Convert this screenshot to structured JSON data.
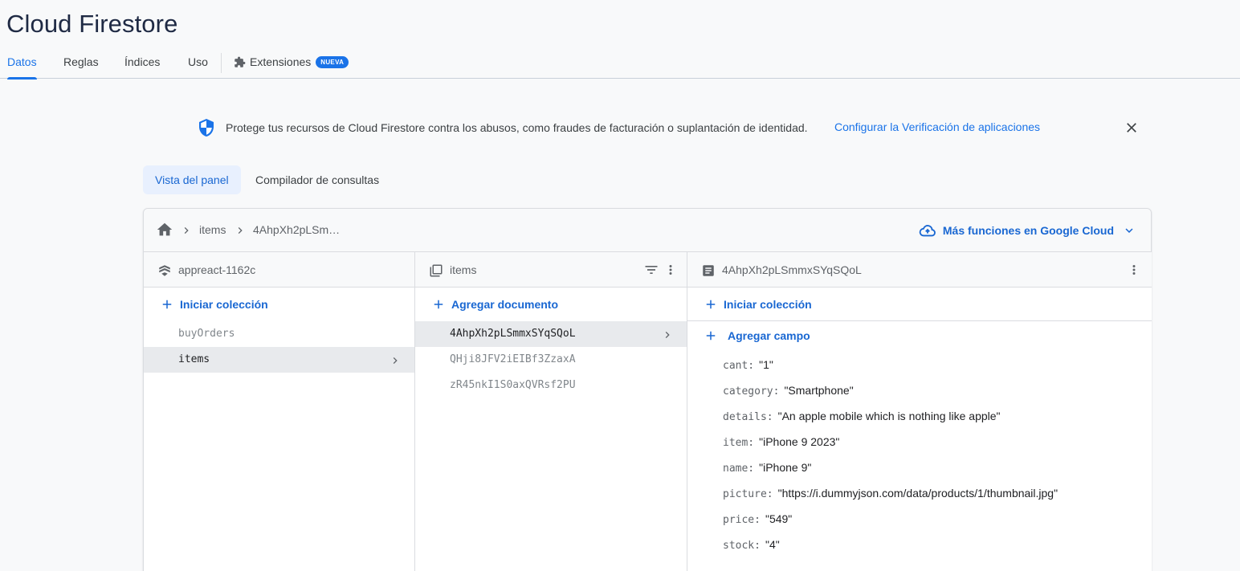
{
  "page": {
    "title": "Cloud Firestore"
  },
  "tabs": [
    {
      "label": "Datos"
    },
    {
      "label": "Reglas"
    },
    {
      "label": "Índices"
    },
    {
      "label": "Uso"
    },
    {
      "label": "Extensiones",
      "badge": "NUEVA"
    }
  ],
  "banner": {
    "text": "Protege tus recursos de Cloud Firestore contra los abusos, como fraudes de facturación o suplantación de identidad.",
    "link": "Configurar la Verificación de aplicaciones"
  },
  "view_tabs": [
    {
      "label": "Vista del panel"
    },
    {
      "label": "Compilador de consultas"
    }
  ],
  "breadcrumb": {
    "items": [
      "items",
      "4AhpXh2pLSm…"
    ],
    "more": "Más funciones en Google Cloud"
  },
  "col1": {
    "title": "appreact-1162c",
    "add": "Iniciar colección",
    "items": [
      "buyOrders",
      "items"
    ]
  },
  "col2": {
    "title": "items",
    "add": "Agregar documento",
    "items": [
      "4AhpXh2pLSmmxSYqSQoL",
      "QHji8JFV2iEIBf3ZzaxA",
      "zR45nkI1S0axQVRsf2PU"
    ]
  },
  "col3": {
    "title": "4AhpXh2pLSmmxSYqSQoL",
    "add": "Iniciar colección",
    "add_field": "Agregar campo",
    "fields": [
      {
        "key": "cant:",
        "value": "\"1\""
      },
      {
        "key": "category:",
        "value": "\"Smartphone\""
      },
      {
        "key": "details:",
        "value": "\"An apple mobile which is nothing like apple\""
      },
      {
        "key": "item:",
        "value": "\"iPhone 9 2023\""
      },
      {
        "key": "name:",
        "value": "\"iPhone 9\""
      },
      {
        "key": "picture:",
        "value": "\"https://i.dummyjson.com/data/products/1/thumbnail.jpg\""
      },
      {
        "key": "price:",
        "value": "\"549\""
      },
      {
        "key": "stock:",
        "value": "\"4\""
      }
    ]
  },
  "colors": {
    "accent": "#1a73e8",
    "link": "#1967d2",
    "selected_row": "#e8eaed"
  }
}
